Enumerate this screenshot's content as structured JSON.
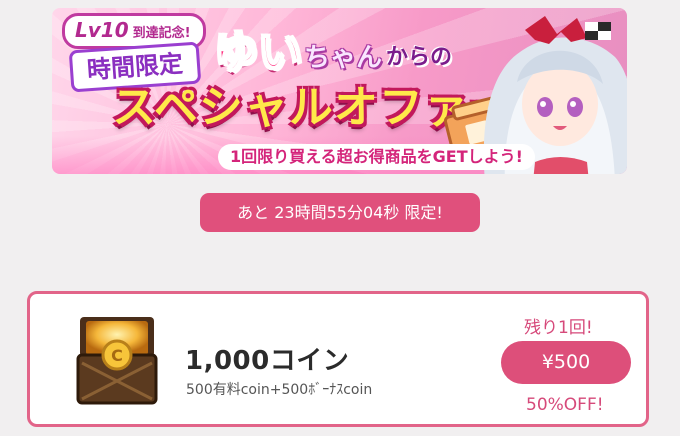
{
  "banner": {
    "level_badge": "Lv10",
    "level_badge_sub": "到達記念!",
    "limited_label": "時間限定",
    "character_name": "ゆい",
    "character_suffix": "ちゃん",
    "from_label": "からの",
    "headline": "スペシャルオファー",
    "tagline": "1回限り買える超お得商品をGETしよう!"
  },
  "timer": {
    "text": "あと 23時間55分04秒 限定!"
  },
  "offer": {
    "title": "1,000コイン",
    "description": "500有料coin+500ﾎﾞｰﾅｽcoin",
    "remaining": "残り1回!",
    "price": "¥500",
    "discount": "50%OFF!",
    "icon": "coin-chest-icon"
  },
  "colors": {
    "accent": "#e0507c",
    "card_border": "#e26489",
    "background": "#f1eff0"
  }
}
